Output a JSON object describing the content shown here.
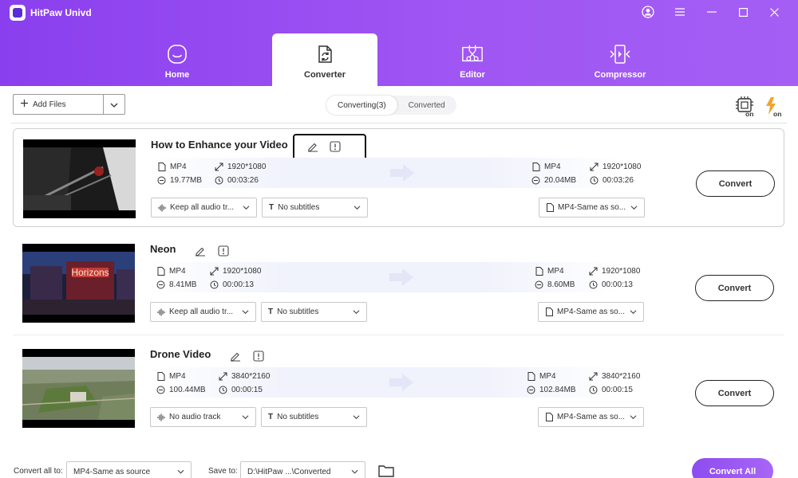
{
  "window": {
    "title": "HitPaw Univd",
    "controls": [
      "account-icon",
      "menu-icon",
      "minimize-icon",
      "maximize-icon",
      "close-icon"
    ]
  },
  "nav": {
    "tabs": [
      {
        "label": "Home",
        "icon": "home-icon",
        "active": false
      },
      {
        "label": "Converter",
        "icon": "converter-icon",
        "active": true
      },
      {
        "label": "Editor",
        "icon": "editor-icon",
        "active": false
      },
      {
        "label": "Compressor",
        "icon": "compressor-icon",
        "active": false
      }
    ]
  },
  "toolbar": {
    "add_files_label": "Add Files",
    "subtabs": [
      {
        "label": "Converting(3)",
        "active": true
      },
      {
        "label": "Converted",
        "active": false
      }
    ],
    "hw_accel_badge": "on",
    "lightning_badge": "on"
  },
  "videos": [
    {
      "title": "How to Enhance your Video",
      "selected": true,
      "source": {
        "format": "MP4",
        "resolution": "1920*1080",
        "size": "19.77MB",
        "duration": "00:03:26"
      },
      "target": {
        "format": "MP4",
        "resolution": "1920*1080",
        "size": "20.04MB",
        "duration": "00:03:26"
      },
      "audio": "Keep all audio tr...",
      "subtitles": "No subtitles",
      "output_format": "MP4-Same as so...",
      "convert_label": "Convert"
    },
    {
      "title": "Neon",
      "selected": false,
      "source": {
        "format": "MP4",
        "resolution": "1920*1080",
        "size": "8.41MB",
        "duration": "00:00:13"
      },
      "target": {
        "format": "MP4",
        "resolution": "1920*1080",
        "size": "8.60MB",
        "duration": "00:00:13"
      },
      "audio": "Keep all audio tr...",
      "subtitles": "No subtitles",
      "output_format": "MP4-Same as so...",
      "convert_label": "Convert",
      "thumb_sign": "Horizons"
    },
    {
      "title": "Drone Video",
      "selected": false,
      "source": {
        "format": "MP4",
        "resolution": "3840*2160",
        "size": "100.44MB",
        "duration": "00:00:15"
      },
      "target": {
        "format": "MP4",
        "resolution": "3840*2160",
        "size": "102.84MB",
        "duration": "00:00:15"
      },
      "audio": "No audio track",
      "subtitles": "No subtitles",
      "output_format": "MP4-Same as so...",
      "convert_label": "Convert"
    }
  ],
  "footer": {
    "convert_all_to_label": "Convert all to:",
    "convert_all_to_value": "MP4-Same as source",
    "save_to_label": "Save to:",
    "save_to_value": "D:\\HitPaw ...\\Converted",
    "convert_all_label": "Convert All"
  },
  "colors": {
    "header_start": "#8a3fee",
    "header_end": "#a45ef4",
    "accent": "#9b59f2"
  }
}
